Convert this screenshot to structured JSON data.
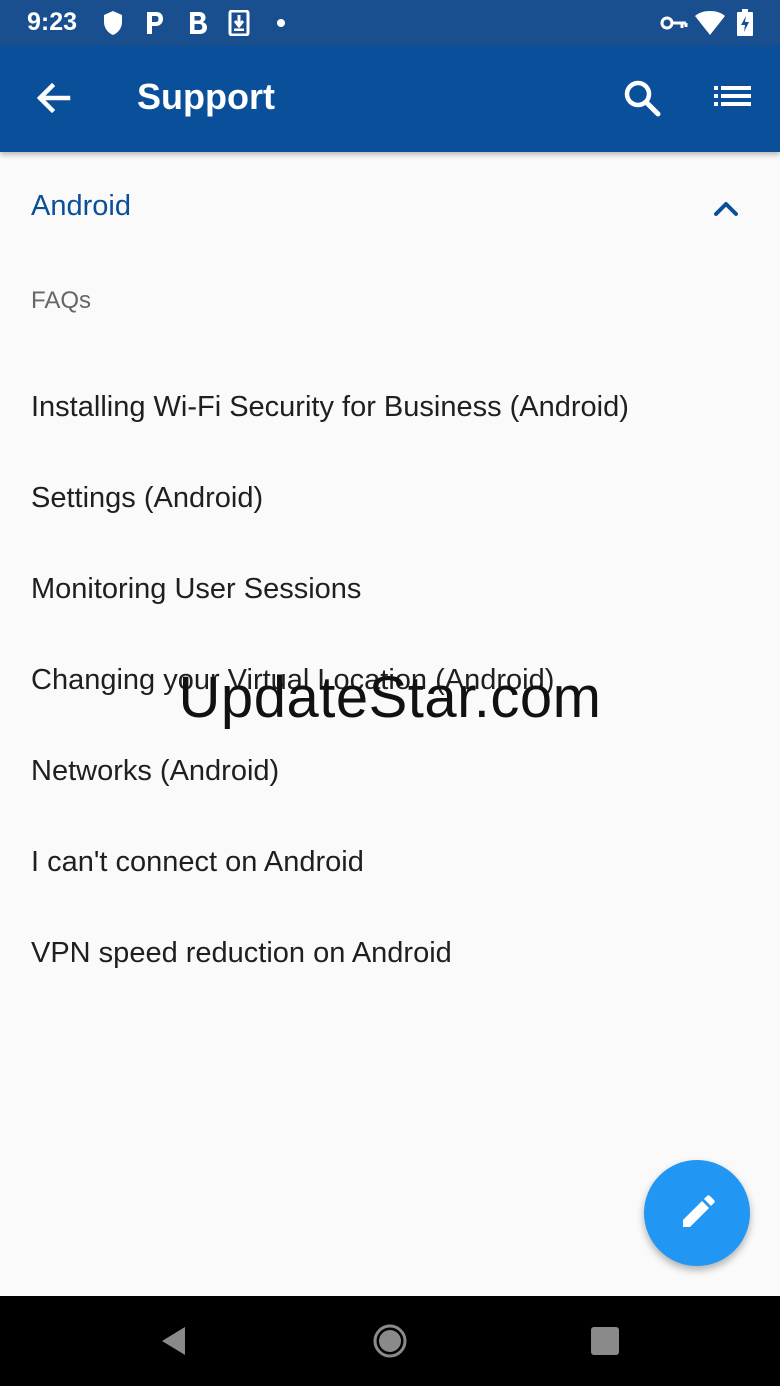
{
  "status_bar": {
    "time": "9:23",
    "left_icons": [
      "shield-icon",
      "p-app-icon",
      "b-app-icon",
      "download-icon",
      "dot-icon"
    ],
    "right_icons": [
      "vpn-key-icon",
      "wifi-icon",
      "battery-charging-icon"
    ]
  },
  "app_bar": {
    "title": "Support",
    "back_icon": "arrow-left-icon",
    "search_icon": "search-icon",
    "menu_icon": "list-icon",
    "color": "#0a4f99"
  },
  "section": {
    "title": "Android",
    "expanded": true,
    "chevron_icon": "chevron-up-icon"
  },
  "faqs": {
    "label": "FAQs",
    "items": [
      {
        "label": "Installing Wi-Fi Security for Business (Android)"
      },
      {
        "label": "Settings (Android)"
      },
      {
        "label": "Monitoring User Sessions"
      },
      {
        "label": "Changing your Virtual Location (Android)"
      },
      {
        "label": "Networks (Android)"
      },
      {
        "label": "I can't connect on Android"
      },
      {
        "label": "VPN speed reduction on Android"
      }
    ]
  },
  "watermark": "UpdateStar.com",
  "fab": {
    "icon": "pencil-icon",
    "color": "#2196f3"
  },
  "nav_bar": {
    "icons": [
      "back-triangle-icon",
      "home-circle-icon",
      "recents-square-icon"
    ]
  }
}
